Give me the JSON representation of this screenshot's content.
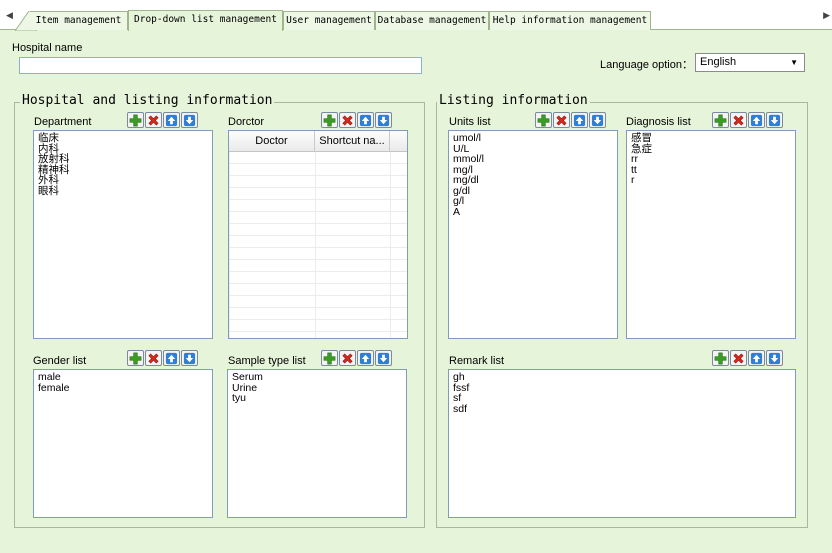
{
  "tabs": [
    {
      "label": "Item management",
      "active": false
    },
    {
      "label": "Drop-down list management",
      "active": true
    },
    {
      "label": "User management",
      "active": false
    },
    {
      "label": "Database management",
      "active": false
    },
    {
      "label": "Help information management",
      "active": false
    }
  ],
  "hospital": {
    "label": "Hospital name",
    "value": ""
  },
  "language": {
    "label": "Language option：",
    "selected": "English"
  },
  "groups": {
    "left_title": "Hospital and listing information",
    "right_title": "Listing information"
  },
  "panels": {
    "department": {
      "label": "Department",
      "items": [
        "临床",
        "内科",
        "放射科",
        "精神科",
        "外科",
        "眼科"
      ]
    },
    "doctor": {
      "label": "Dorctor",
      "columns": [
        "Doctor",
        "Shortcut na..."
      ]
    },
    "gender": {
      "label": "Gender list",
      "items": [
        "male",
        "female"
      ]
    },
    "sample_type": {
      "label": "Sample type list",
      "items": [
        "Serum",
        "Urine",
        "tyu"
      ]
    },
    "units": {
      "label": "Units list",
      "items": [
        "umol/l",
        "U/L",
        "mmol/l",
        "mg/l",
        "mg/dl",
        "g/dl",
        "g/l",
        "A"
      ]
    },
    "diagnosis": {
      "label": "Diagnosis list",
      "items": [
        "感冒",
        "急症",
        "rr",
        "tt",
        "r"
      ]
    },
    "remark": {
      "label": "Remark list",
      "items": [
        "gh",
        "fssf",
        "sf",
        "sdf"
      ]
    }
  },
  "toolbar_icons": [
    "add-icon",
    "delete-icon",
    "move-up-icon",
    "move-down-icon"
  ],
  "colors": {
    "background": "#e6f4da",
    "add": "#3a9d23",
    "delete": "#d42a1c",
    "arrow": "#2f7fd6"
  }
}
